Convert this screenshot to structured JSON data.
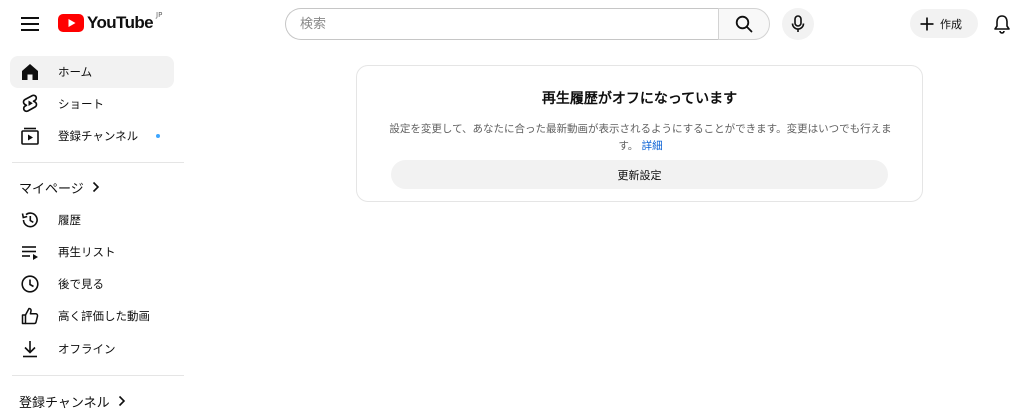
{
  "header": {
    "logo_text": "YouTube",
    "logo_region": "JP",
    "search_placeholder": "検索",
    "create_label": "作成"
  },
  "sidebar": {
    "main": [
      {
        "label": "ホーム",
        "icon": "home-icon",
        "active": true
      },
      {
        "label": "ショート",
        "icon": "shorts-icon"
      },
      {
        "label": "登録チャンネル",
        "icon": "subscriptions-icon",
        "badge_dot": true
      }
    ],
    "you_section": {
      "label": "マイページ",
      "items": [
        {
          "label": "履歴",
          "icon": "history-icon"
        },
        {
          "label": "再生リスト",
          "icon": "playlists-icon"
        },
        {
          "label": "後で見る",
          "icon": "watch-later-icon"
        },
        {
          "label": "高く評価した動画",
          "icon": "liked-videos-icon"
        },
        {
          "label": "オフライン",
          "icon": "downloads-icon"
        }
      ]
    },
    "subscriptions_section": {
      "label": "登録チャンネル"
    }
  },
  "notice": {
    "title": "再生履歴がオフになっています",
    "body": "設定を変更して、あなたに合った最新動画が表示されるようにすることができます。変更はいつでも行えます。",
    "link": "詳細",
    "button": "更新設定"
  },
  "colors": {
    "brand_red": "#ff0000",
    "link_blue": "#065fd4",
    "dot_blue": "#3ea6ff",
    "chip_bg": "#f2f2f2"
  }
}
